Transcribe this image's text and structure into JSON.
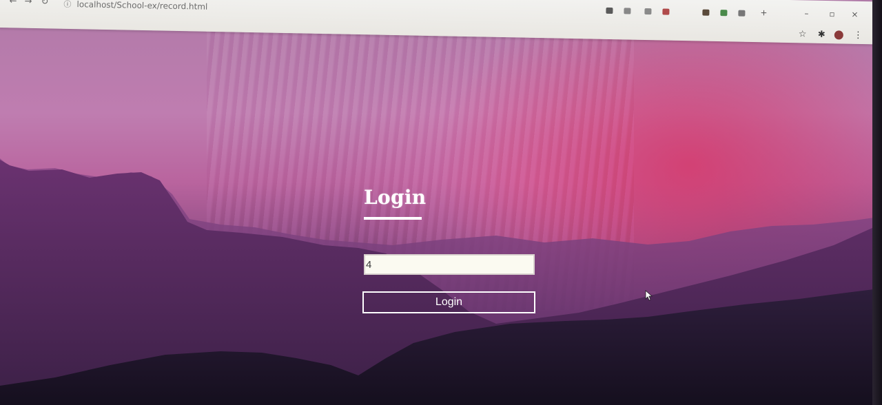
{
  "browser": {
    "url": "localhost/School-ex/record.html",
    "nav_back_icon": "back-arrow-icon",
    "nav_forward_icon": "forward-arrow-icon",
    "reload_icon": "reload-icon",
    "site_info_icon": "info-icon",
    "bookmark_icon": "star-icon",
    "extensions_icon": "puzzle-icon",
    "profile_icon": "avatar-icon",
    "menu_icon": "kebab-menu-icon",
    "window_controls": [
      "minimize-icon",
      "maximize-icon",
      "close-icon"
    ]
  },
  "login": {
    "title": "Login",
    "input_value": "4",
    "button_label": "Login"
  },
  "colors": {
    "title_text": "#ffffff",
    "input_background": "#fbfaf1",
    "button_border": "#ffffff",
    "sky_top": "#b07aa8",
    "sky_glow": "#d63a6c",
    "mountain_far": "#7a3f7a",
    "mountain_near": "#1f1530"
  }
}
